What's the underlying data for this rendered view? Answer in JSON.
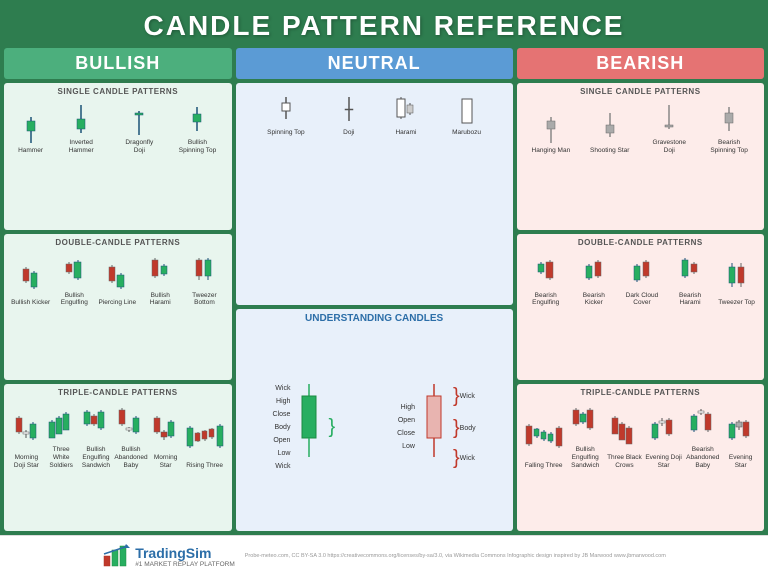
{
  "header": {
    "title": "CANDLE PATTERN REFERENCE"
  },
  "columns": {
    "bullish": {
      "label": "BULLISH",
      "color": "#4caf7d",
      "single_title": "SINGLE CANDLE PATTERNS",
      "single_patterns": [
        {
          "name": "Hammer"
        },
        {
          "name": "Inverted Hammer"
        },
        {
          "name": "Dragonfly Doji"
        },
        {
          "name": "Bullish Spinning Top"
        }
      ],
      "double_title": "DOUBLE-CANDLE PATTERNS",
      "double_patterns": [
        {
          "name": "Bullish Kicker"
        },
        {
          "name": "Bullish Engulfing"
        },
        {
          "name": "Piercing Line"
        },
        {
          "name": "Bullish Harami"
        },
        {
          "name": "Tweezer Bottom"
        }
      ],
      "triple_title": "TRIPLE-CANDLE PATTERNS",
      "triple_patterns": [
        {
          "name": "Morning Doji Star"
        },
        {
          "name": "Three White Soldiers"
        },
        {
          "name": "Bullish Engulfing Sandwich"
        },
        {
          "name": "Bullish Abandoned Baby"
        },
        {
          "name": "Morning Star"
        },
        {
          "name": "Rising Three"
        }
      ]
    },
    "neutral": {
      "label": "NEUTRAL",
      "color": "#5b9bd5",
      "single_patterns": [
        {
          "name": "Spinning Top"
        },
        {
          "name": "Doji"
        },
        {
          "name": "Harami"
        },
        {
          "name": "Marubozu"
        }
      ],
      "understanding_title": "UNDERSTANDING CANDLES",
      "candle_parts": {
        "wick_top": "Wick",
        "high": "High",
        "open_close": "Open/Close",
        "body": "Body",
        "low": "Low",
        "wick_bottom": "Wick"
      }
    },
    "bearish": {
      "label": "BEARISH",
      "color": "#e57373",
      "single_title": "SINGLE CANDLE PATTERNS",
      "single_patterns": [
        {
          "name": "Hanging Man"
        },
        {
          "name": "Shooting Star"
        },
        {
          "name": "Gravestone Doji"
        },
        {
          "name": "Bearish Spinning Top"
        }
      ],
      "double_title": "DOUBLE-CANDLE PATTERNS",
      "double_patterns": [
        {
          "name": "Bearish Engulfing"
        },
        {
          "name": "Bearish Kicker"
        },
        {
          "name": "Dark Cloud Cover"
        },
        {
          "name": "Bearish Harami"
        },
        {
          "name": "Tweezer Top"
        }
      ],
      "triple_title": "TRIPLE-CANDLE PATTERNS",
      "triple_patterns": [
        {
          "name": "Falling Three"
        },
        {
          "name": "Bullish Engulfing Sandwich"
        },
        {
          "name": "Three Black Crows"
        },
        {
          "name": "Evening Doji Star"
        },
        {
          "name": "Bearish Abandoned Baby"
        },
        {
          "name": "Evening Star"
        }
      ]
    }
  },
  "footer": {
    "brand_name": "TradingSim",
    "brand_sub": "#1 MARKET REPLAY PLATFORM",
    "attribution": "Probe-meteo.com, CC BY-SA 3.0 https://creativecommons.org/licenses/by-sa/3.0, via Wikimedia Commons   Infographic design inspired by JB Marwood www.jbmarwood.com"
  }
}
